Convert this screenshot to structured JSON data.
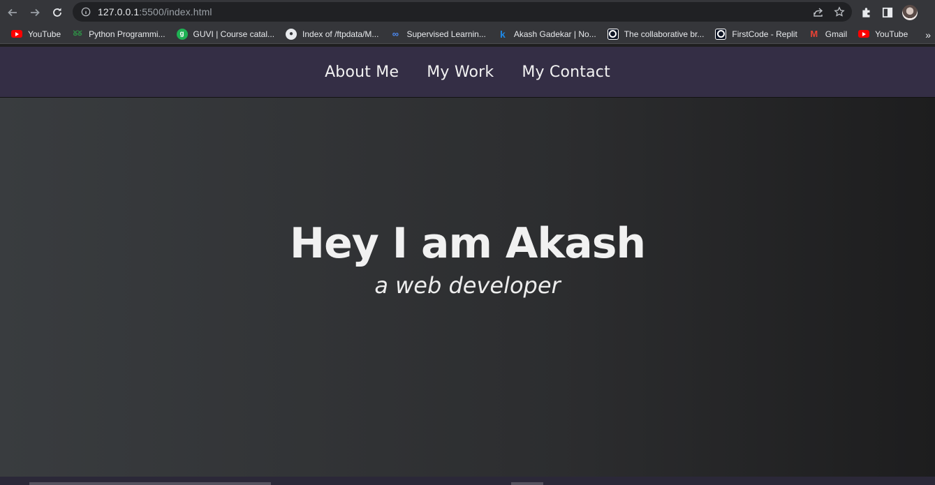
{
  "browser": {
    "url_host": "127.0.0.1",
    "url_rest": ":5500/index.html",
    "bookmarks": [
      {
        "label": "YouTube",
        "icon": "youtube-icon"
      },
      {
        "label": "Python Programmi...",
        "icon": "geeksforgeeks-icon"
      },
      {
        "label": "GUVI | Course catal...",
        "icon": "guvi-icon"
      },
      {
        "label": "Index of /ftpdata/M...",
        "icon": "globe-icon"
      },
      {
        "label": "Supervised Learnin...",
        "icon": "infinity-icon"
      },
      {
        "label": "Akash Gadekar | No...",
        "icon": "kaggle-icon"
      },
      {
        "label": "The collaborative br...",
        "icon": "replit-icon"
      },
      {
        "label": "FirstCode - Replit",
        "icon": "replit-icon"
      },
      {
        "label": "Gmail",
        "icon": "gmail-icon"
      },
      {
        "label": "YouTube",
        "icon": "youtube-icon"
      }
    ],
    "bookmarks_more": "»"
  },
  "nav": {
    "items": [
      {
        "label": "About Me"
      },
      {
        "label": "My Work"
      },
      {
        "label": "My Contact"
      }
    ]
  },
  "hero": {
    "title": "Hey I am Akash",
    "subtitle": "a web developer"
  },
  "colors": {
    "nav_bg": "#342e45",
    "hero_bg_left": "#393c3f",
    "hero_bg_right": "#1d1d1e",
    "text": "#f1f1f1"
  }
}
